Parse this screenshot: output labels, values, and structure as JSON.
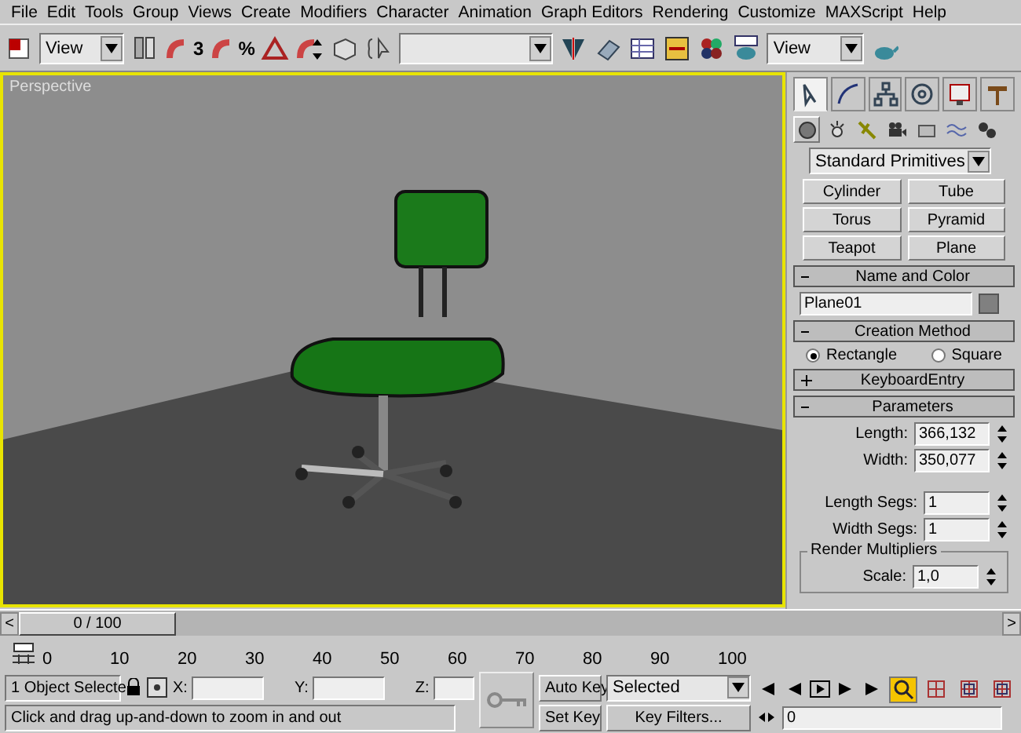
{
  "menu": [
    "File",
    "Edit",
    "Tools",
    "Group",
    "Views",
    "Create",
    "Modifiers",
    "Character",
    "Animation",
    "Graph Editors",
    "Rendering",
    "Customize",
    "MAXScript",
    "Help"
  ],
  "toolbar": {
    "view_dropdown": "View",
    "snap_labels": [
      "3",
      "%"
    ],
    "named_selection_dropdown": {
      "open": false
    },
    "render_dropdown": "View"
  },
  "viewport": {
    "label": "Perspective",
    "active": true
  },
  "command_panel": {
    "tabs": [
      {
        "selected": true
      },
      {
        "selected": false
      },
      {
        "selected": false
      },
      {
        "selected": false
      },
      {
        "selected": false
      },
      {
        "selected": false
      }
    ],
    "categories": [
      {
        "selected": true
      },
      {
        "selected": false
      },
      {
        "selected": false
      },
      {
        "selected": false
      },
      {
        "selected": false
      },
      {
        "selected": false
      },
      {
        "selected": false
      }
    ],
    "type_dropdown": "Standard Primitives",
    "object_buttons": [
      "Cylinder",
      "Tube",
      "Torus",
      "Pyramid",
      "Teapot",
      "Plane"
    ],
    "rollouts": [
      {
        "kind": "name",
        "title": "Name and Color",
        "expanded": true,
        "name": "Plane01",
        "color": "#808080"
      },
      {
        "kind": "radios",
        "title": "Creation Method",
        "expanded": true,
        "options": [
          {
            "label": "Rectangle",
            "selected": true
          },
          {
            "label": "Square",
            "selected": false
          }
        ]
      },
      {
        "title": "KeyboardEntry",
        "expanded": false
      },
      {
        "kind": "params",
        "title": "Parameters",
        "expanded": true,
        "fields": [
          {
            "label": "Length:",
            "value": "366,132"
          },
          {
            "label": "Width:",
            "value": "350,077"
          }
        ],
        "segs": [
          {
            "label": "Length Segs:",
            "value": "1"
          },
          {
            "label": "Width Segs:",
            "value": "1"
          }
        ],
        "group": {
          "title": "Render Multipliers",
          "fields": [
            {
              "label": "Scale:",
              "value": "1,0"
            }
          ]
        }
      }
    ]
  },
  "time_slider": {
    "prev": "<",
    "position": "0 / 100",
    "next": ">",
    "level": 0
  },
  "track_ticks": [
    "0",
    "10",
    "20",
    "30",
    "40",
    "50",
    "60",
    "70",
    "80",
    "90",
    "100"
  ],
  "status": {
    "selection": "1 Object Selecte",
    "x_label": "X:",
    "y_label": "Y:",
    "z_label": "Z:",
    "auto_key": "Auto Key",
    "key_mode": "Selected",
    "set_key": "Set Key",
    "key_filters": "Key Filters...",
    "prompt": "Click and drag up-and-down to zoom in and out",
    "frame": "0"
  },
  "nav_tools": [
    {
      "selected": true
    },
    {
      "selected": false
    },
    {
      "selected": false
    },
    {
      "selected": false
    }
  ]
}
